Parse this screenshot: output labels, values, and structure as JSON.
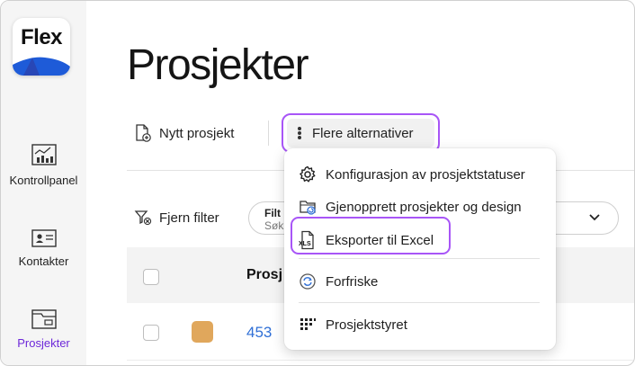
{
  "app": {
    "logo_text": "Flex"
  },
  "sidebar": {
    "items": [
      {
        "label": "Kontrollpanel",
        "icon": "dashboard-icon",
        "active": false
      },
      {
        "label": "Kontakter",
        "icon": "contact-card-icon",
        "active": false
      },
      {
        "label": "Prosjekter",
        "icon": "project-folder-icon",
        "active": true
      }
    ]
  },
  "main": {
    "title": "Prosjekter",
    "toolbar": {
      "new_project_label": "Nytt prosjekt",
      "more_options_label": "Flere alternativer"
    },
    "filter": {
      "clear_label": "Fjern filter",
      "field_label": "Filt",
      "field_placeholder": "Søk"
    },
    "table": {
      "columns": [
        "Prosj"
      ],
      "rows": [
        {
          "id": "453",
          "color": "#e0a75c"
        }
      ]
    }
  },
  "menu": {
    "items": [
      {
        "label": "Konfigurasjon av prosjektstatuser",
        "icon": "gear-icon"
      },
      {
        "label": "Gjenopprett prosjekter og design",
        "icon": "folder-restore-icon"
      },
      {
        "label": "Eksporter til Excel",
        "icon": "xls-file-icon"
      },
      {
        "label": "Forfriske",
        "icon": "refresh-icon"
      },
      {
        "label": "Prosjektstyret",
        "icon": "grid-board-icon"
      }
    ],
    "export_icon_text": "XLS"
  },
  "colors": {
    "accent": "#a855f7",
    "link": "#2f6fd6",
    "active_nav": "#6d28d9"
  }
}
